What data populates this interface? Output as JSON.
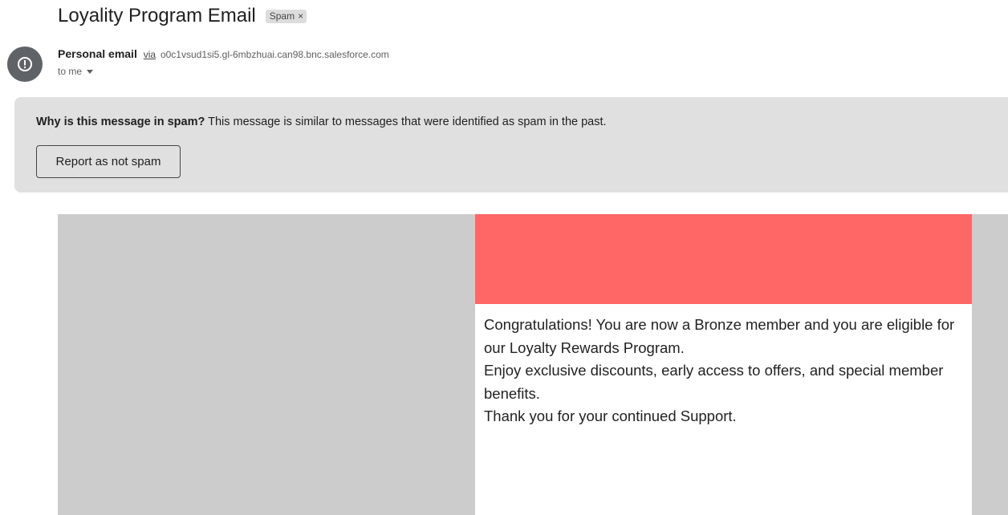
{
  "subject": "Loyality Program Email",
  "label_chip": {
    "text": "Spam",
    "remove_symbol": "×"
  },
  "sender": {
    "avatar_icon": "alert-circle-icon",
    "name": "Personal email",
    "via": "via",
    "domain": "o0c1vsud1si5.gl-6mbzhuai.can98.bnc.salesforce.com",
    "to": "to me"
  },
  "spam_banner": {
    "question": "Why is this message in spam?",
    "explanation": " This message is similar to messages that were identified as spam in the past.",
    "button_label": "Report as not spam"
  },
  "email_body": {
    "hero_color": "#ff6666",
    "lines": [
      "Congratulations! You are now a Bronze member and you are eligible for our Loyalty Rewards Program.",
      "Enjoy exclusive discounts, early access to offers, and special member benefits.",
      "Thank you for your continued Support."
    ]
  }
}
